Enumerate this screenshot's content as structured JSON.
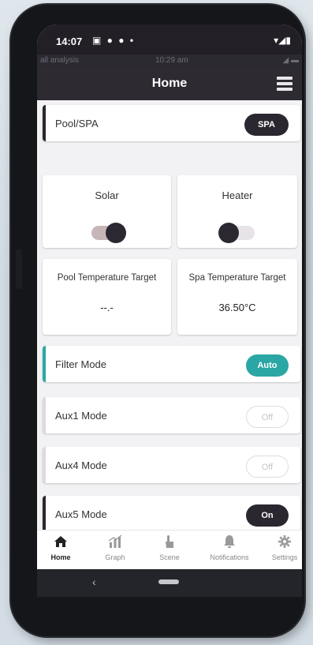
{
  "status_bar": {
    "time": "14:07",
    "notif_icons": "▣ ● ● •",
    "right_icons": "▾◢▮"
  },
  "sub_status": {
    "carrier": "all analysis",
    "clock": "10:29 am",
    "battery": "◢ ▬"
  },
  "header": {
    "title": "Home",
    "menu_icon": "menu-icon"
  },
  "pool_spa": {
    "label": "Pool/SPA",
    "button": "SPA"
  },
  "solar": {
    "label": "Solar",
    "state": "on"
  },
  "heater": {
    "label": "Heater",
    "state": "off"
  },
  "pool_temp": {
    "label": "Pool Temperature Target",
    "value": "--.-"
  },
  "spa_temp": {
    "label": "Spa Temperature Target",
    "value": "36.50°C"
  },
  "modes": [
    {
      "label": "Filter Mode",
      "button": "Auto",
      "accent": "#2aa7a4"
    },
    {
      "label": "Aux1 Mode",
      "button": "Off"
    },
    {
      "label": "Aux4 Mode",
      "button": "Off"
    },
    {
      "label": "Aux5 Mode",
      "button": "On"
    }
  ],
  "tabs": [
    {
      "label": "Home",
      "icon": "home-icon"
    },
    {
      "label": "Graph",
      "icon": "graph-icon"
    },
    {
      "label": "Scene",
      "icon": "scene-icon"
    },
    {
      "label": "Notifications",
      "icon": "bell-icon"
    },
    {
      "label": "Settings",
      "icon": "gear-icon"
    }
  ],
  "colors": {
    "header": "#2d2a31",
    "accent": "#2aa7a4",
    "dark": "#2b2730"
  }
}
